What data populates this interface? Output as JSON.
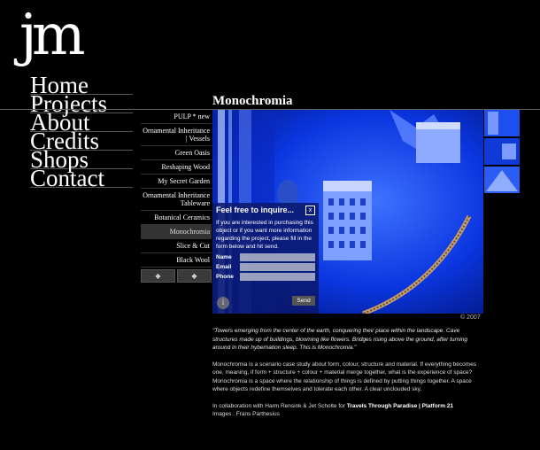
{
  "logo": "jm",
  "nav": [
    "Home",
    "Projects",
    "About",
    "Credits",
    "Shops",
    "Contact"
  ],
  "page_title": "Monochromia",
  "projects": [
    "PULP * new",
    "Ornamental Inheritance | Vessels",
    "Green Oasis",
    "Reshaping Wood",
    "My Secret Garden",
    "Ornamental Inheritance Tableware",
    "Botanical Ceramics",
    "Monochromia",
    "Slice & Cut",
    "Black Wool"
  ],
  "arrows": {
    "prev": "◆",
    "next": "◆"
  },
  "copyright": "© 2007",
  "inquire": {
    "title": "Feel free to inquire...",
    "close": "x",
    "text": "If you are interested in purchasing this object or if you want more information regarding the project, please fill in the form below and hit send.",
    "name_label": "Name",
    "email_label": "Email",
    "phone_label": "Phone",
    "info_icon": "i",
    "send_label": "Send"
  },
  "description": {
    "quote": "\"Towers emerging from the center of the earth, conquering their place within the landscape. Cave structures made up of buildings, blooming like flowers. Bridges rising above the ground, after turning around in their hybernation sleep. This is Monochromia.\"",
    "body": "Monochromia is a scenario case study about form, colour, structure and material. If everything becomes one, meaning, if form + structure + colour + material merge together, what is the experience of space? Monochromia is a space where the relationship of things is defined by putting things together. A space where objects redefine themselves and tolerate each other. A clear unclouded sky.",
    "collab_prefix": "In collaboration with Harm Rensink & Jet Scholte for ",
    "collab_bold": "Travels Through Paradise | Platform 21",
    "images": "Images : Frans Parthesius"
  },
  "colors": {
    "background": "#000000",
    "accent_blue": "#0b2fd6",
    "overlay": "#0a196e"
  }
}
